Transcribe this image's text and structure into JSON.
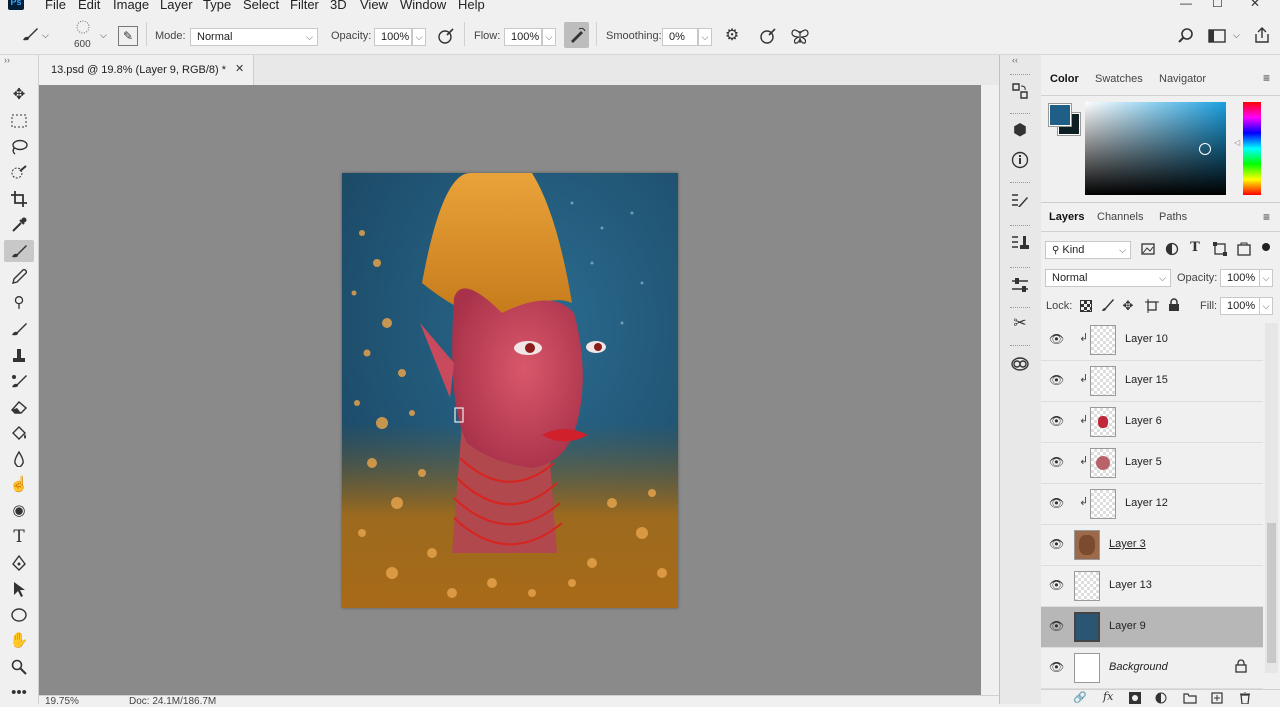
{
  "app": {
    "logo": "Ps"
  },
  "menu": [
    "File",
    "Edit",
    "Image",
    "Layer",
    "Type",
    "Select",
    "Filter",
    "3D",
    "View",
    "Window",
    "Help"
  ],
  "window_controls": {
    "minimize": "—",
    "maximize": "☐",
    "close": "✕"
  },
  "options": {
    "brush_size": "600",
    "mode_label": "Mode:",
    "mode_value": "Normal",
    "opacity_label": "Opacity:",
    "opacity_value": "100%",
    "flow_label": "Flow:",
    "flow_value": "100%",
    "smoothing_label": "Smoothing:",
    "smoothing_value": "0%"
  },
  "document": {
    "tab_title": "13.psd @ 19.8% (Layer 9, RGB/8) *",
    "tab_close": "✕",
    "zoom": "19.75%",
    "doc_size": "Doc: 24.1M/186.7M"
  },
  "color_panel": {
    "tabs": [
      "Color",
      "Swatches",
      "Navigator"
    ],
    "active_tab": "Color",
    "foreground": "#1f5e86",
    "background": "#0d1f22"
  },
  "layers_panel": {
    "tabs": [
      "Layers",
      "Channels",
      "Paths"
    ],
    "active_tab": "Layers",
    "filter_label": "Kind",
    "blend_mode": "Normal",
    "opacity_label": "Opacity:",
    "opacity_value": "100%",
    "lock_label": "Lock:",
    "fill_label": "Fill:",
    "fill_value": "100%",
    "layers": [
      {
        "name": "Layer 10",
        "clipped": true,
        "thumb": "transparent"
      },
      {
        "name": "Layer 15",
        "clipped": true,
        "thumb": "transparent"
      },
      {
        "name": "Layer 6",
        "clipped": true,
        "thumb": "red-lips"
      },
      {
        "name": "Layer 5",
        "clipped": true,
        "thumb": "pink-blob"
      },
      {
        "name": "Layer 12",
        "clipped": true,
        "thumb": "transparent"
      },
      {
        "name": "Layer 3",
        "clipped": false,
        "thumb": "skin"
      },
      {
        "name": "Layer 13",
        "clipped": false,
        "thumb": "transparent"
      },
      {
        "name": "Layer 9",
        "clipped": false,
        "thumb": "blue",
        "selected": true
      },
      {
        "name": "Background",
        "clipped": false,
        "thumb": "white",
        "locked": true
      }
    ]
  },
  "icons": {
    "brush": "brush-icon",
    "settings": "gear-icon",
    "search": "search-icon",
    "lock": "lock-icon",
    "eye": "eye-icon"
  }
}
